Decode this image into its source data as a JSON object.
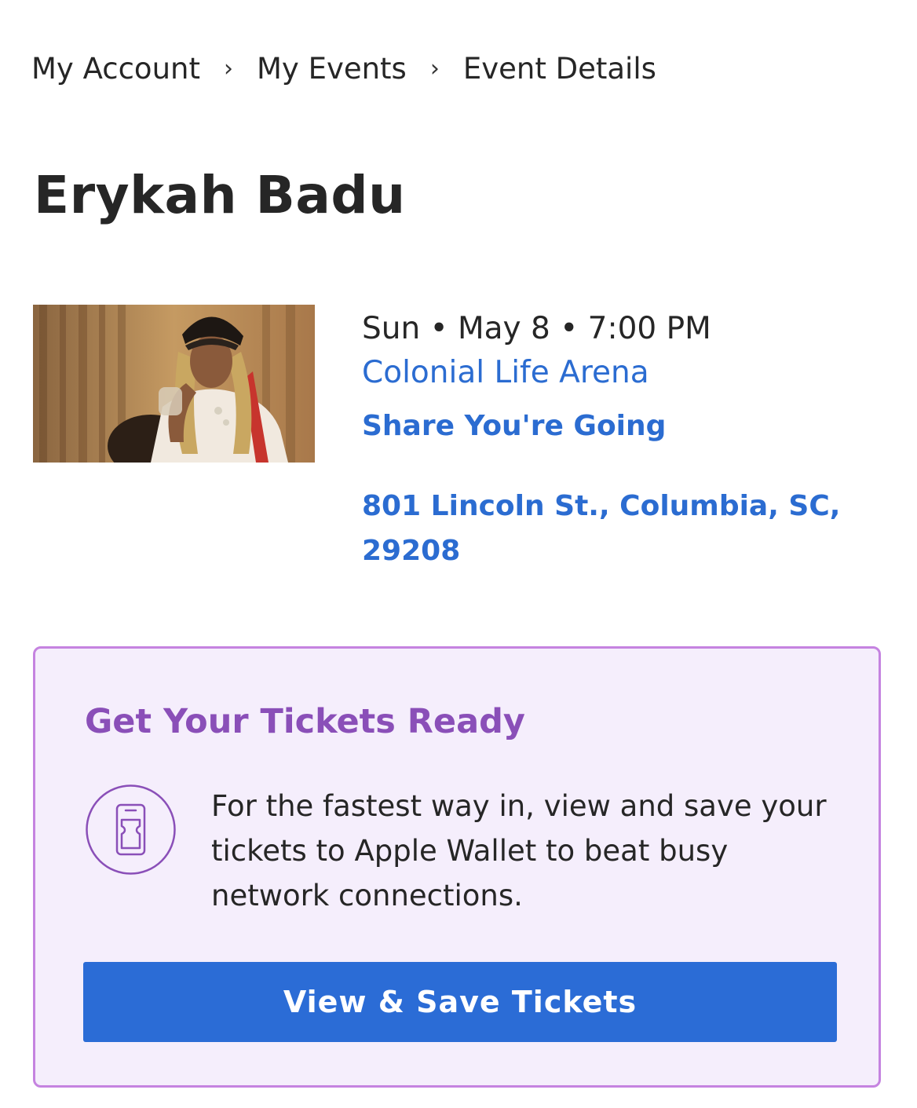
{
  "breadcrumb": {
    "items": [
      "My Account",
      "My Events",
      "Event Details"
    ],
    "separator": "›"
  },
  "event": {
    "title": "Erykah Badu",
    "datetime": "Sun • May 8 • 7:00 PM",
    "venue": "Colonial Life Arena",
    "share_label": "Share You're Going",
    "address": "801 Lincoln St., Columbia, SC, 29208"
  },
  "tickets_card": {
    "title": "Get Your Tickets Ready",
    "icon": "phone-ticket-icon",
    "description": "For the fastest way in, view and save your tickets to Apple Wallet to beat busy network connections.",
    "button_label": "View & Save Tickets"
  },
  "colors": {
    "link": "#2b6cd1",
    "accent_purple": "#8a4fb8",
    "card_border": "#c583e0",
    "card_background": "#f5eefc",
    "button": "#2b6cd6"
  }
}
